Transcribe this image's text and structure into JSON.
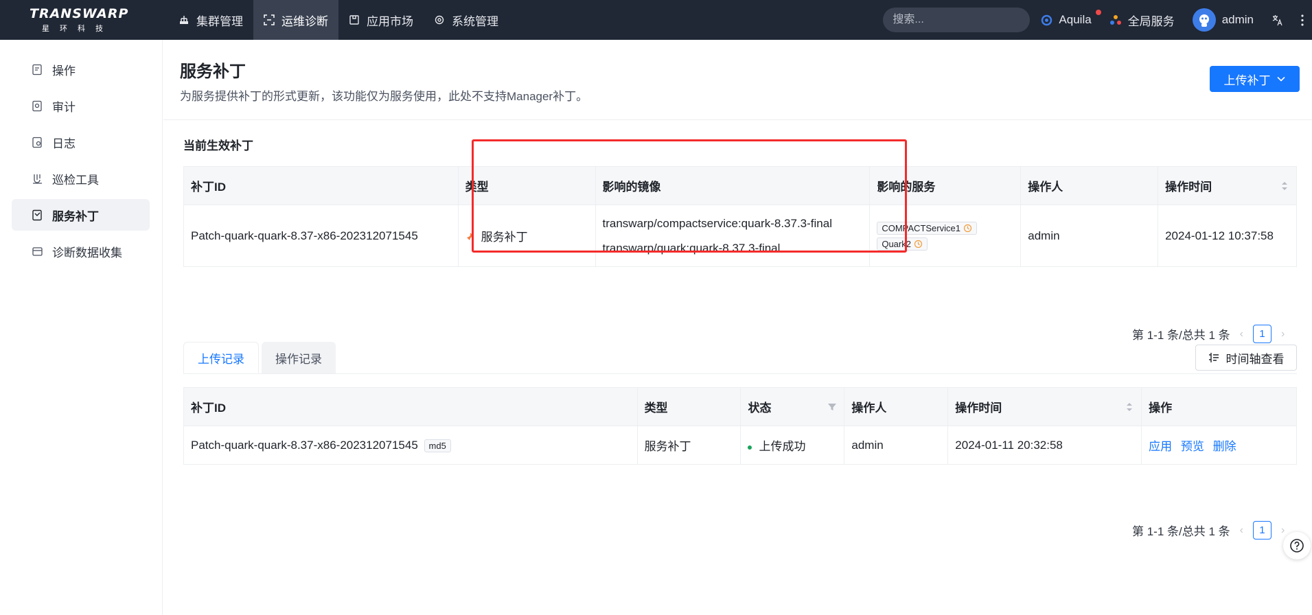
{
  "brand": {
    "name": "TRANSWARP",
    "subtitle": "星环科技"
  },
  "nav": [
    {
      "label": "集群管理",
      "icon": "cluster-icon"
    },
    {
      "label": "运维诊断",
      "icon": "scan-icon",
      "active": true
    },
    {
      "label": "应用市场",
      "icon": "store-icon"
    },
    {
      "label": "系统管理",
      "icon": "gear-icon"
    }
  ],
  "topright": {
    "search_placeholder": "搜索...",
    "aquila": "Aquila",
    "global_service": "全局服务",
    "user": "admin"
  },
  "sidebar": [
    {
      "label": "操作",
      "icon": "operation-icon"
    },
    {
      "label": "审计",
      "icon": "audit-icon"
    },
    {
      "label": "日志",
      "icon": "log-icon"
    },
    {
      "label": "巡检工具",
      "icon": "inspect-icon"
    },
    {
      "label": "服务补丁",
      "icon": "patch-icon",
      "active": true
    },
    {
      "label": "诊断数据收集",
      "icon": "collect-icon"
    }
  ],
  "page": {
    "title": "服务补丁",
    "description": "为服务提供补丁的形式更新，该功能仅为服务使用，此处不支持Manager补丁。",
    "upload_button": "上传补丁"
  },
  "current": {
    "section_title": "当前生效补丁",
    "columns": [
      "补丁ID",
      "类型",
      "影响的镜像",
      "影响的服务",
      "操作人",
      "操作时间"
    ],
    "row": {
      "patch_id": "Patch-quark-quark-8.37-x86-202312071545",
      "type": "服务补丁",
      "images": [
        "transwarp/compactservice:quark-8.37.3-final",
        "transwarp/quark:quark-8.37.3-final"
      ],
      "services": [
        "COMPACTService1",
        "Quark2"
      ],
      "operator": "admin",
      "time": "2024-01-12 10:37:58"
    },
    "pager": {
      "summary": "第 1-1 条/总共 1 条",
      "page": "1"
    }
  },
  "history": {
    "tabs": [
      "上传记录",
      "操作记录"
    ],
    "timeline_button": "时间轴查看",
    "columns": [
      "补丁ID",
      "类型",
      "状态",
      "操作人",
      "操作时间",
      "操作"
    ],
    "row": {
      "patch_id": "Patch-quark-quark-8.37-x86-202312071545",
      "md5": "md5",
      "type": "服务补丁",
      "status": "上传成功",
      "operator": "admin",
      "time": "2024-01-11 20:32:58",
      "actions": [
        "应用",
        "预览",
        "删除"
      ]
    },
    "pager": {
      "summary": "第 1-1 条/总共 1 条",
      "page": "1"
    }
  },
  "colors": {
    "accent": "#1677ff",
    "topbar": "#202735",
    "highlight": "#f52a2a",
    "success": "#1aa35b"
  }
}
